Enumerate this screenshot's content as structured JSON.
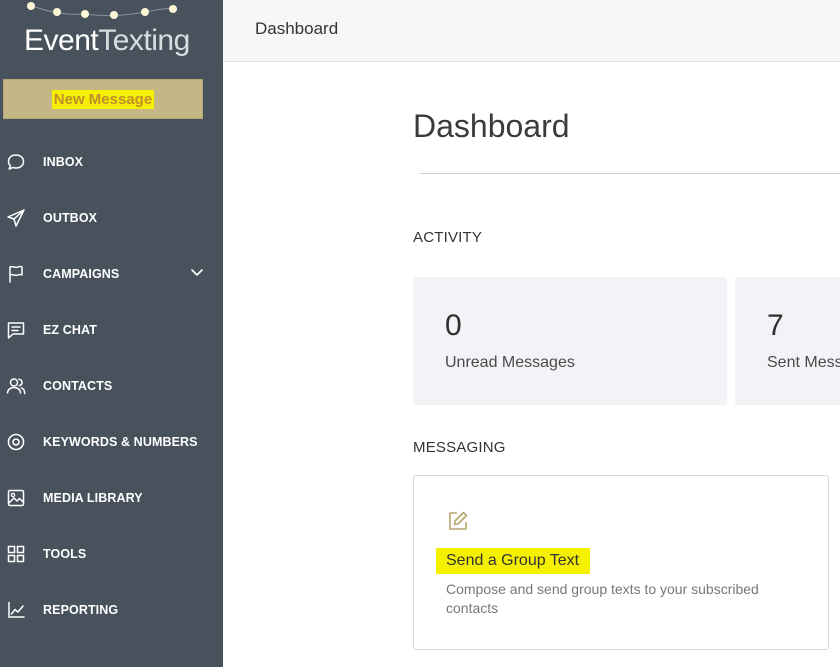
{
  "brand": {
    "logo_bold": "Event",
    "logo_thin": "Texting"
  },
  "sidebar": {
    "new_message_label": "New Message",
    "items": [
      {
        "label": "INBOX",
        "icon": "chat-bubble-icon"
      },
      {
        "label": "OUTBOX",
        "icon": "paper-plane-icon"
      },
      {
        "label": "CAMPAIGNS",
        "icon": "flag-icon",
        "has_dropdown": true
      },
      {
        "label": "EZ CHAT",
        "icon": "message-square-icon"
      },
      {
        "label": "CONTACTS",
        "icon": "users-icon"
      },
      {
        "label": "KEYWORDS & NUMBERS",
        "icon": "target-icon"
      },
      {
        "label": "MEDIA LIBRARY",
        "icon": "image-icon"
      },
      {
        "label": "TOOLS",
        "icon": "grid-icon"
      },
      {
        "label": "REPORTING",
        "icon": "line-chart-icon"
      }
    ]
  },
  "header": {
    "title": "Dashboard"
  },
  "main": {
    "title": "Dashboard",
    "activity": {
      "label": "ACTIVITY",
      "stats": [
        {
          "value": "0",
          "caption": "Unread Messages"
        },
        {
          "value": "7",
          "caption": "Sent Messages"
        }
      ]
    },
    "messaging": {
      "label": "MESSAGING",
      "card": {
        "title": "Send a Group Text",
        "description": "Compose and send group texts to your subscribed contacts",
        "icon": "edit-icon"
      }
    }
  },
  "colors": {
    "sidebar_bg": "#47525c",
    "new_message_bg": "#c5b686",
    "highlight": "#f4f000",
    "stat_card_bg": "#f2f3f6"
  }
}
